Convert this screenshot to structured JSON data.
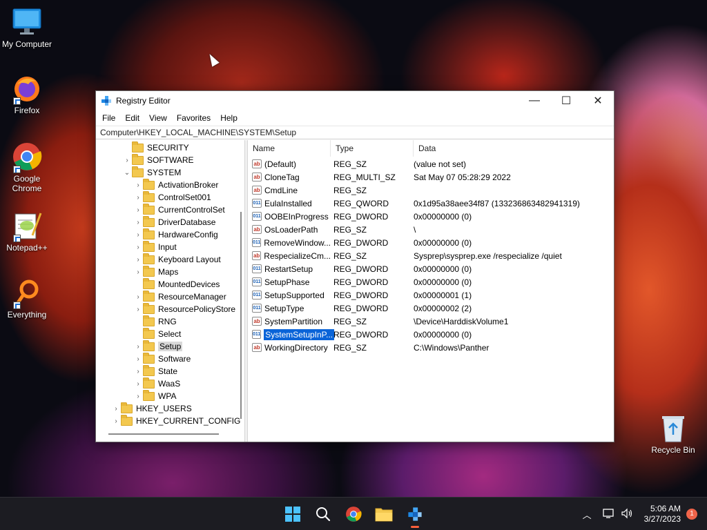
{
  "desktop": {
    "icons": [
      {
        "label": "My Computer",
        "icon": "monitor-icon"
      },
      {
        "label": "Firefox",
        "icon": "firefox-icon"
      },
      {
        "label": "Google Chrome",
        "icon": "chrome-icon"
      },
      {
        "label": "Notepad++",
        "icon": "notepadpp-icon"
      },
      {
        "label": "Everything",
        "icon": "everything-search-icon"
      },
      {
        "label": "Recycle Bin",
        "icon": "recycle-bin-icon"
      }
    ]
  },
  "window": {
    "title": "Registry Editor",
    "controls": {
      "minimize": "—",
      "maximize": "☐",
      "close": "✕"
    },
    "menu": [
      "File",
      "Edit",
      "View",
      "Favorites",
      "Help"
    ],
    "address": "Computer\\HKEY_LOCAL_MACHINE\\SYSTEM\\Setup"
  },
  "tree": [
    {
      "label": "SECURITY",
      "expander": ""
    },
    {
      "label": "SOFTWARE",
      "expander": "›"
    },
    {
      "label": "SYSTEM",
      "expander": "⌄"
    },
    {
      "label": "ActivationBroker",
      "expander": "›"
    },
    {
      "label": "ControlSet001",
      "expander": "›"
    },
    {
      "label": "CurrentControlSet",
      "expander": "›"
    },
    {
      "label": "DriverDatabase",
      "expander": "›"
    },
    {
      "label": "HardwareConfig",
      "expander": "›"
    },
    {
      "label": "Input",
      "expander": "›"
    },
    {
      "label": "Keyboard Layout",
      "expander": "›"
    },
    {
      "label": "Maps",
      "expander": "›"
    },
    {
      "label": "MountedDevices",
      "expander": ""
    },
    {
      "label": "ResourceManager",
      "expander": "›"
    },
    {
      "label": "ResourcePolicyStore",
      "expander": "›"
    },
    {
      "label": "RNG",
      "expander": ""
    },
    {
      "label": "Select",
      "expander": ""
    },
    {
      "label": "Setup",
      "expander": "›",
      "selected": true
    },
    {
      "label": "Software",
      "expander": "›"
    },
    {
      "label": "State",
      "expander": "›"
    },
    {
      "label": "WaaS",
      "expander": "›"
    },
    {
      "label": "WPA",
      "expander": "›"
    },
    {
      "label": "HKEY_USERS",
      "expander": "›"
    },
    {
      "label": "HKEY_CURRENT_CONFIG",
      "expander": "›"
    }
  ],
  "list": {
    "headers": [
      "Name",
      "Type",
      "Data"
    ],
    "rows": [
      {
        "name": "(Default)",
        "type": "REG_SZ",
        "data": "(value not set)",
        "icon": "ab"
      },
      {
        "name": "CloneTag",
        "type": "REG_MULTI_SZ",
        "data": "Sat May 07 05:28:29 2022",
        "icon": "ab"
      },
      {
        "name": "CmdLine",
        "type": "REG_SZ",
        "data": "",
        "icon": "ab"
      },
      {
        "name": "EulaInstalled",
        "type": "REG_QWORD",
        "data": "0x1d95a38aee34f87 (133236863482941319)",
        "icon": "bin"
      },
      {
        "name": "OOBEInProgress",
        "type": "REG_DWORD",
        "data": "0x00000000 (0)",
        "icon": "bin"
      },
      {
        "name": "OsLoaderPath",
        "type": "REG_SZ",
        "data": "\\",
        "icon": "ab"
      },
      {
        "name": "RemoveWindow...",
        "type": "REG_DWORD",
        "data": "0x00000000 (0)",
        "icon": "bin"
      },
      {
        "name": "RespecializeCm...",
        "type": "REG_SZ",
        "data": "Sysprep\\sysprep.exe /respecialize /quiet",
        "icon": "ab"
      },
      {
        "name": "RestartSetup",
        "type": "REG_DWORD",
        "data": "0x00000000 (0)",
        "icon": "bin"
      },
      {
        "name": "SetupPhase",
        "type": "REG_DWORD",
        "data": "0x00000000 (0)",
        "icon": "bin"
      },
      {
        "name": "SetupSupported",
        "type": "REG_DWORD",
        "data": "0x00000001 (1)",
        "icon": "bin"
      },
      {
        "name": "SetupType",
        "type": "REG_DWORD",
        "data": "0x00000002 (2)",
        "icon": "bin"
      },
      {
        "name": "SystemPartition",
        "type": "REG_SZ",
        "data": "\\Device\\HarddiskVolume1",
        "icon": "ab"
      },
      {
        "name": "SystemSetupInP...",
        "type": "REG_DWORD",
        "data": "0x00000000 (0)",
        "icon": "bin",
        "selected": true
      },
      {
        "name": "WorkingDirectory",
        "type": "REG_SZ",
        "data": "C:\\Windows\\Panther",
        "icon": "ab"
      }
    ]
  },
  "taskbar": {
    "apps": [
      "windows-start-icon",
      "search-icon",
      "chrome-icon",
      "file-explorer-icon",
      "registry-editor-icon"
    ],
    "active": "registry-editor-icon",
    "time": "5:06 AM",
    "date": "3/27/2023",
    "notifications": "1"
  },
  "colors": {
    "selection": "#0a64d8",
    "accent": "#ff5f3b",
    "folder": "#f3c84f"
  }
}
